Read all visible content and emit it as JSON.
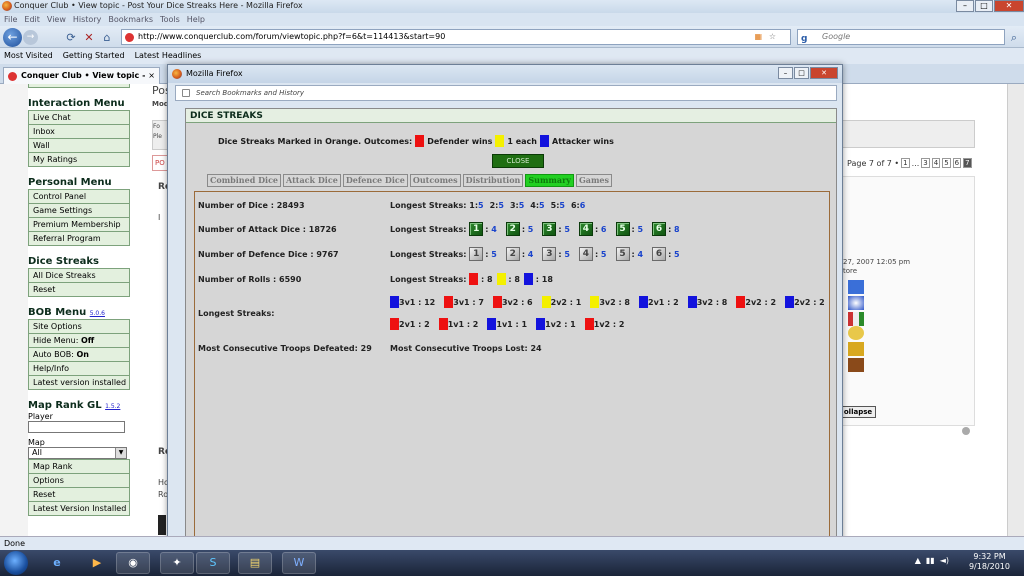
{
  "window": {
    "title": "Conquer Club • View topic - Post Your Dice Streaks Here - Mozilla Firefox"
  },
  "menu": [
    "File",
    "Edit",
    "View",
    "History",
    "Bookmarks",
    "Tools",
    "Help"
  ],
  "nav": {
    "url": "http://www.conquerclub.com/forum/viewtopic.php?f=6&t=114413&start=90",
    "search_placeholder": "Google",
    "back": "←",
    "fwd": "→",
    "refresh": "⟳",
    "stop": "✕",
    "home": "⌂",
    "rss": "▦",
    "star": "☆",
    "go": "⌕"
  },
  "bookmarks": [
    "Most Visited",
    "Getting Started",
    "Latest Headlines"
  ],
  "tab": {
    "label": "Conquer Club • View topic - Post ...",
    "close": "×"
  },
  "sidebar": {
    "interaction_title": "Interaction Menu",
    "interaction": [
      "Live Chat",
      "Inbox",
      "Wall",
      "My Ratings"
    ],
    "personal_title": "Personal Menu",
    "personal": [
      "Control Panel",
      "Game Settings",
      "Premium Membership",
      "Referral Program"
    ],
    "dice_title": "Dice Streaks",
    "dice": [
      "All Dice Streaks",
      "Reset"
    ],
    "bob_title": "BOB Menu",
    "bob_version": "5.0.6",
    "bob": [
      "Site Options",
      "Hide Menu:",
      "Auto BOB:",
      "Help/Info",
      "Latest version installed"
    ],
    "bob_hide_value": "Off",
    "bob_auto_value": "On",
    "maprank_title": "Map Rank GL",
    "maprank_version": "1.5.2",
    "player_label": "Player",
    "map_label": "Map",
    "map_value": "All",
    "maprank": [
      "Map Rank",
      "Options",
      "Reset",
      "Latest Version Installed"
    ]
  },
  "background": {
    "post_prefix": "Pos",
    "mod": "Mod",
    "fo": "Fo",
    "pl": "Ple",
    "po": "PO",
    "re1": "Re",
    "re2": "Re",
    "i": "I",
    "ho": "Ho",
    "ro": "Ro",
    "pagination": "Page 7 of 7 •",
    "pages": [
      "1",
      "...",
      "3",
      "4",
      "5",
      "6",
      "7"
    ],
    "date": "27, 2007 12:05 pm",
    "store": "tore",
    "collapse": "ollapse"
  },
  "popup": {
    "title": "Mozilla Firefox",
    "search": "Search Bookmarks and History",
    "min": "–",
    "max": "□",
    "close": "✕"
  },
  "dice": {
    "header": "DICE STREAKS",
    "legend_prefix": "Dice Streaks Marked in Orange. Outcomes:",
    "legend_red": "Defender wins",
    "legend_yellow": "1 each",
    "legend_blue": "Attacker wins",
    "close": "CLOSE",
    "tabs": [
      "Combined Dice",
      "Attack Dice",
      "Defence Dice",
      "Outcomes",
      "Distribution",
      "Summary",
      "Games"
    ],
    "active_tab": "Summary",
    "num_dice": "Number of Dice : 28493",
    "num_attack": "Number of Attack Dice : 18726",
    "num_defence": "Number of Defence Dice : 9767",
    "num_rolls": "Number of Rolls : 6590",
    "ls_label": "Longest Streaks:",
    "ls_all": [
      {
        "k": "1:",
        "v": "5"
      },
      {
        "k": "2:",
        "v": "5"
      },
      {
        "k": "3:",
        "v": "5"
      },
      {
        "k": "4:",
        "v": "5"
      },
      {
        "k": "5:",
        "v": "5"
      },
      {
        "k": "6:",
        "v": "6"
      }
    ],
    "ls_attack": [
      {
        "d": "1",
        "v": "4"
      },
      {
        "d": "2",
        "v": "5"
      },
      {
        "d": "3",
        "v": "5"
      },
      {
        "d": "4",
        "v": "6"
      },
      {
        "d": "5",
        "v": "5"
      },
      {
        "d": "6",
        "v": "8"
      }
    ],
    "ls_defence": [
      {
        "d": "1",
        "v": "5"
      },
      {
        "d": "2",
        "v": "4"
      },
      {
        "d": "3",
        "v": "5"
      },
      {
        "d": "4",
        "v": "5"
      },
      {
        "d": "5",
        "v": "4"
      },
      {
        "d": "6",
        "v": "5"
      }
    ],
    "ls_rolls": [
      {
        "c": "red",
        "v": "8"
      },
      {
        "c": "yel",
        "v": "8"
      },
      {
        "c": "blu",
        "v": "18"
      }
    ],
    "ls_outcomes_label": "Longest Streaks:",
    "ls_outcomes_row1": [
      {
        "c": "blu",
        "t": "3v1 : 12"
      },
      {
        "c": "red",
        "t": "3v1 : 7"
      },
      {
        "c": "red",
        "t": "3v2 : 6"
      },
      {
        "c": "yel",
        "t": "2v2 : 1"
      },
      {
        "c": "yel",
        "t": "3v2 : 8"
      },
      {
        "c": "blu",
        "t": "2v1 : 2"
      },
      {
        "c": "blu",
        "t": "3v2 : 8"
      },
      {
        "c": "red",
        "t": "2v2 : 2"
      },
      {
        "c": "blu",
        "t": "2v2 : 2"
      }
    ],
    "ls_outcomes_row2": [
      {
        "c": "red",
        "t": "2v1 : 2"
      },
      {
        "c": "red",
        "t": "1v1 : 2"
      },
      {
        "c": "blu",
        "t": "1v1 : 1"
      },
      {
        "c": "blu",
        "t": "1v2 : 1"
      },
      {
        "c": "red",
        "t": "1v2 : 2"
      }
    ],
    "troops_defeated": "Most Consecutive Troops Defeated: 29",
    "troops_lost": "Most Consecutive Troops Lost: 24",
    "colors": {
      "red": "#ee1111",
      "yellow": "#f4f000",
      "blue": "#1313dd",
      "green": "#1f6e12"
    }
  },
  "status": "Done",
  "clock": {
    "time": "9:32 PM",
    "date": "9/18/2010"
  }
}
